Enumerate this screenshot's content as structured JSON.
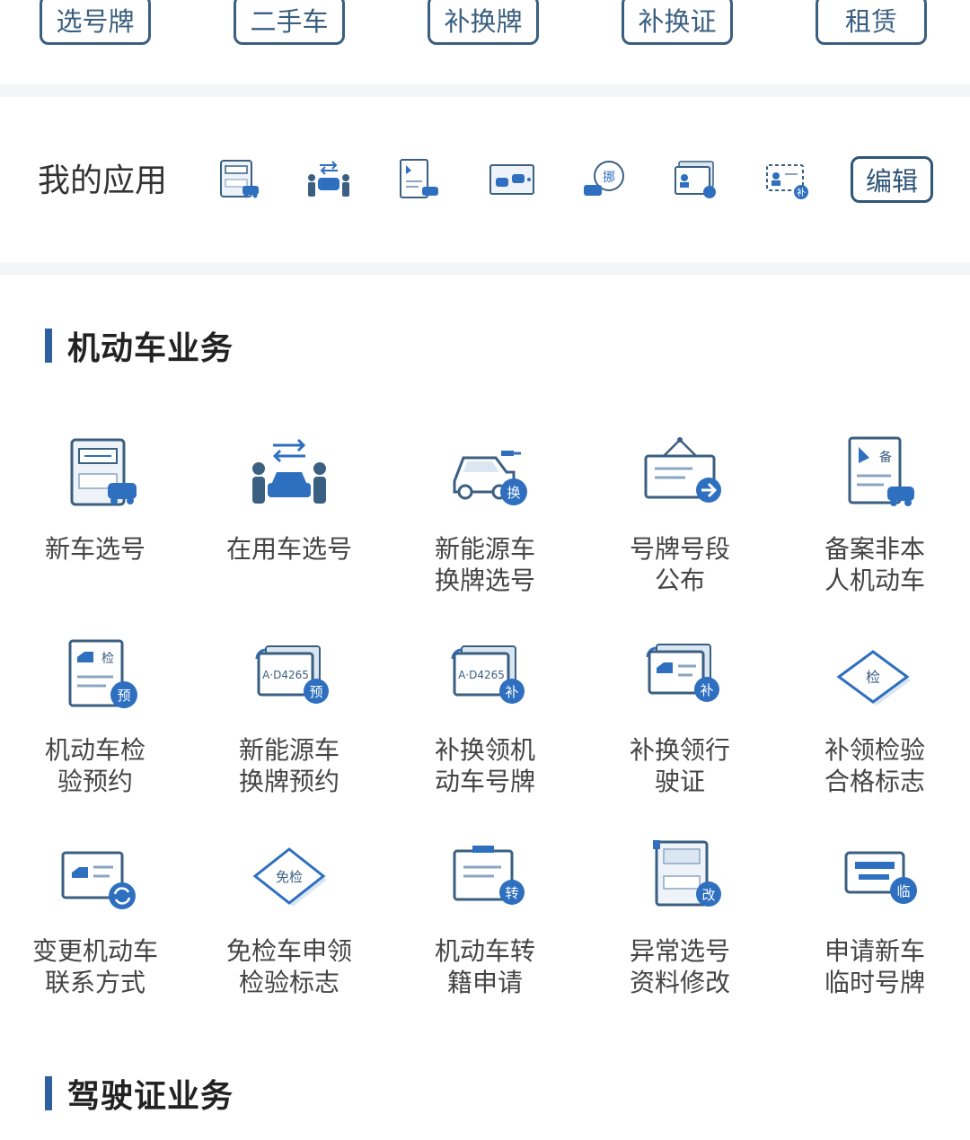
{
  "top_tabs": [
    "选号牌",
    "二手车",
    "补换牌",
    "补换证",
    "租赁"
  ],
  "my_apps": {
    "title": "我的应用",
    "edit_label": "编辑",
    "icons": [
      "plate-selection-icon",
      "car-transfer-icon",
      "registration-record-icon",
      "plate-photo-icon",
      "move-car-icon",
      "license-card-icon",
      "reissue-card-icon"
    ]
  },
  "sections": {
    "vehicle": {
      "title": "机动车业务"
    },
    "license": {
      "title": "驾驶证业务"
    }
  },
  "vehicle_services": [
    {
      "label": "新车选号",
      "icon": "new-car-number-icon",
      "badge": ""
    },
    {
      "label": "在用车选号",
      "icon": "used-car-number-icon",
      "badge": ""
    },
    {
      "label": "新能源车\n换牌选号",
      "icon": "ev-plate-change-icon",
      "badge": "换"
    },
    {
      "label": "号牌号段\n公布",
      "icon": "plate-range-notice-icon",
      "badge": ""
    },
    {
      "label": "备案非本\n人机动车",
      "icon": "record-vehicle-icon",
      "badge": ""
    },
    {
      "label": "机动车检\n验预约",
      "icon": "inspection-booking-icon",
      "badge": "预"
    },
    {
      "label": "新能源车\n换牌预约",
      "icon": "ev-plate-booking-icon",
      "badge": "预"
    },
    {
      "label": "补换领机\n动车号牌",
      "icon": "plate-reissue-icon",
      "badge": "补"
    },
    {
      "label": "补换领行\n驶证",
      "icon": "driving-permit-reissue-icon",
      "badge": "补"
    },
    {
      "label": "补领检验\n合格标志",
      "icon": "inspection-mark-icon",
      "badge": "检"
    },
    {
      "label": "变更机动车\n联系方式",
      "icon": "change-contact-icon",
      "badge": ""
    },
    {
      "label": "免检车申领\n检验标志",
      "icon": "exempt-inspection-icon",
      "badge": "免检"
    },
    {
      "label": "机动车转\n籍申请",
      "icon": "transfer-registry-icon",
      "badge": "转"
    },
    {
      "label": "异常选号\n资料修改",
      "icon": "abnormal-number-edit-icon",
      "badge": "改"
    },
    {
      "label": "申请新车\n临时号牌",
      "icon": "temporary-plate-icon",
      "badge": "临"
    }
  ],
  "colors": {
    "accent": "#2e6fc0",
    "border": "#3a5f80",
    "light": "#dbe6f3",
    "background_band": "#f4f5f7"
  }
}
